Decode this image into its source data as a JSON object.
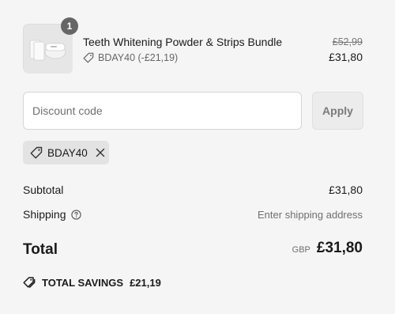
{
  "colors": {
    "background": "#f5f5f5",
    "badge": "#666666",
    "muted_text": "#6f6f6f",
    "pill_bg": "#e3e3e3"
  },
  "line_item": {
    "quantity": "1",
    "name": "Teeth Whitening Powder & Strips Bundle",
    "discount": "BDAY40 (-£21,19)",
    "price_original": "£52,99",
    "price_final": "£31,80",
    "thumbnail_icon": "product-photo",
    "discount_icon": "tag-icon"
  },
  "discount": {
    "placeholder": "Discount code",
    "value": "",
    "apply_label": "Apply",
    "applied_code": "BDAY40",
    "remove_icon": "close-icon"
  },
  "summary": {
    "subtotal_label": "Subtotal",
    "subtotal_value": "£31,80",
    "shipping_label": "Shipping",
    "shipping_value": "Enter shipping address",
    "shipping_info_icon": "question-circle-icon",
    "total_label": "Total",
    "currency": "GBP",
    "total_value": "£31,80",
    "savings_label": "TOTAL SAVINGS",
    "savings_value": "£21,19",
    "savings_icon": "tags-icon"
  }
}
